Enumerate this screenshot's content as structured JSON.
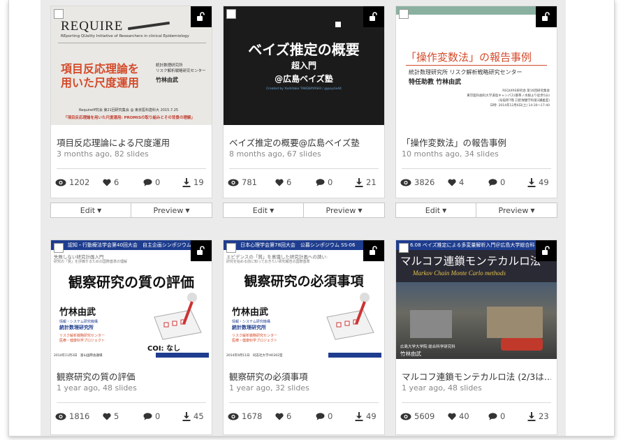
{
  "colors": {
    "accent_red": "#d44a2a",
    "panel_bg": "#ebebeb",
    "icon": "#333333"
  },
  "cards": [
    {
      "title": "項目反応理論による尺度運用",
      "meta": "3 months ago, 82 slides",
      "views": "1202",
      "likes": "6",
      "comments": "0",
      "downloads": "19",
      "slide": {
        "logo": "REQUIRE",
        "logo_sub": "REporting QUality Initiative of Researchers in clinical Epidemiology",
        "heading1": "項目反応理論を",
        "heading2": "用いた尺度運用",
        "org": "統計数理研究所\nリスク解析戦略研究センター",
        "author": "竹林由武",
        "footer1": "Requireiff究会 第21回研究集会 @ 東京医科歯科大 2015.7.25",
        "footer2": "「項目反応理論を用いた尺度運用: PROMISの取り組みとその背景の理解」"
      }
    },
    {
      "title": "ベイズ推定の概要@広島ベイズ塾",
      "meta": "8 months ago, 67 slides",
      "views": "781",
      "likes": "6",
      "comments": "0",
      "downloads": "21",
      "slide": {
        "heading": "ベイズ推定の概要",
        "sub": "超入門",
        "venue": "@広島ベイズ塾",
        "credit": "Created by Yoshitake TAKEBAYASHI / @psycle44"
      }
    },
    {
      "title": "「操作変数法」の報告事例",
      "meta": "10 months ago, 34 slides",
      "views": "3826",
      "likes": "4",
      "comments": "0",
      "downloads": "49",
      "slide": {
        "heading": "「操作変数法」の報告事例",
        "line1": "統計数理研究所 リスク解析戦略研究センター",
        "line2": "特任助教 竹林由武",
        "note1": "REQUIRE研究会 第16回研究集会",
        "note2": "東京医科歯科大学湯島キャンパス(御茶ノ水駅より徒歩5分)",
        "note3": "(号館所7階 口腔保健学科第3講義室)",
        "note4": "日時: 2014年12月6日(土) 14:30〜17:40"
      }
    },
    {
      "title": "観察研究の質の評価",
      "meta": "1 year ago, 48 slides",
      "views": "1816",
      "likes": "5",
      "comments": "0",
      "downloads": "45",
      "slide": {
        "banner": "認知・行動療法学会第40回大会　自主企画シンポジウム",
        "kicker1": "失敗しない研究計画入門",
        "kicker2": "研究の「質」を評価するための国際基準の理解",
        "heading": "観察研究の質の評価",
        "author": "竹林由武",
        "org1": "情報・システム研究機構",
        "org2": "統計数理研究所",
        "org3": "リスク解析戦略研究センター",
        "org4": "医療・健康科学プロジェクト",
        "coi": "COI: なし",
        "date": "2014年11月3日　富山国際会議場"
      }
    },
    {
      "title": "観察研究の必須事項",
      "meta": "1 year ago, 32 slides",
      "views": "1678",
      "likes": "6",
      "comments": "0",
      "downloads": "49",
      "slide": {
        "banner": "日本心理学会第78回大会　公募シンポジウム SS-06",
        "kicker1": "エビデンスの「質」を意識した研究計画への誘い:",
        "kicker2": "研究を始める前に知っておきたい研究報告の国際基準",
        "heading": "観察研究の必須事項",
        "author": "竹林由武",
        "org1": "情報・システム研究機構",
        "org2": "統計数理研究所",
        "org3": "リスク解析戦略研究センター",
        "org4": "医療・健康科学プロジェクト",
        "date": "2014年9月11日　同志社大学HO302室"
      }
    },
    {
      "title": "マルコフ連鎖モンテカルロ法 (2/3は…",
      "meta": "1 year ago, 48 slides",
      "views": "5609",
      "likes": "40",
      "comments": "0",
      "downloads": "23",
      "slide": {
        "banner": "6.08 ベイズ推定による多変量解析入門＠広島大学総合科",
        "heading": "マルコフ連鎖モンテカルロ法",
        "sub": "Markov Chain Monte Carlo methods",
        "caption1": "広島大学大学院 総合科学研究科",
        "caption2": "竹林由武"
      }
    }
  ],
  "actions": {
    "edit": "Edit",
    "preview": "Preview"
  }
}
